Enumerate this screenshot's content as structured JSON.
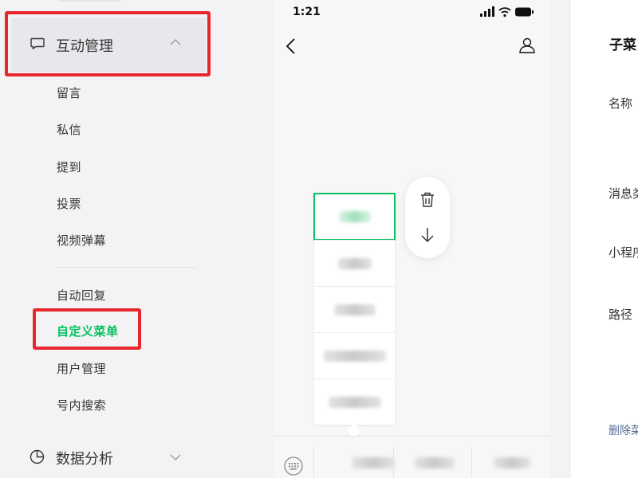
{
  "sidebar": {
    "group": {
      "title": "互动管理",
      "icon": "message-icon"
    },
    "items": [
      {
        "label": "留言"
      },
      {
        "label": "私信"
      },
      {
        "label": "提到"
      },
      {
        "label": "投票"
      },
      {
        "label": "视频弹幕"
      },
      {
        "label": "自动回复"
      },
      {
        "label": "自定义菜单",
        "active": true
      },
      {
        "label": "用户管理"
      },
      {
        "label": "号内搜索"
      }
    ],
    "group2": {
      "title": "数据分析",
      "icon": "pie-chart-icon"
    },
    "accent_color": "#07c160",
    "highlight_color": "#e8262b"
  },
  "phone": {
    "status_time": "1:21",
    "submenu_item_count": 5,
    "main_menu_count": 3
  },
  "panel": {
    "title": "子菜",
    "labels": {
      "name": "名称",
      "message_type": "消息类",
      "mini_program": "小程序",
      "path": "路径",
      "delete": "删除菜"
    },
    "link_color": "#576b95"
  }
}
